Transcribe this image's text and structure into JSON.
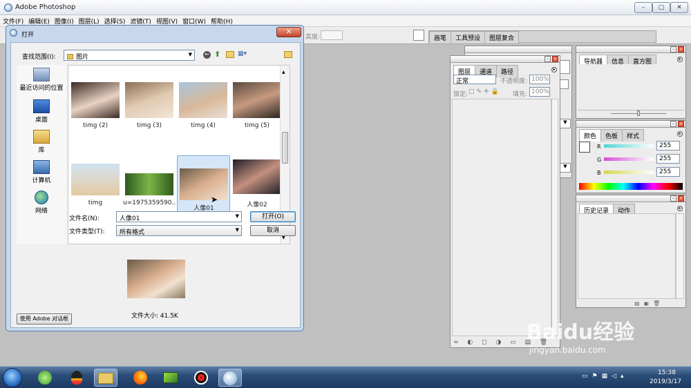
{
  "app": {
    "title": "Adobe Photoshop",
    "window_buttons": [
      "–",
      "▢",
      "✕"
    ]
  },
  "menu": [
    "文件(F)",
    "编辑(E)",
    "图像(I)",
    "图层(L)",
    "选择(S)",
    "滤镜(T)",
    "视图(V)",
    "窗口(W)",
    "帮助(H)"
  ],
  "options_bar": {
    "height_label": "高度:",
    "tabs": [
      "画笔",
      "工具预设",
      "图层复合"
    ]
  },
  "layers_panel": {
    "tabs": [
      "图层",
      "通道",
      "路径"
    ],
    "blend_mode": "正常",
    "opacity_label": "不透明度:",
    "opacity_value": "100%",
    "lock_label": "锁定:",
    "fill_label": "填充:",
    "fill_value": "100%"
  },
  "navigator_panel": {
    "tabs": [
      "导航器",
      "信息",
      "直方图"
    ]
  },
  "color_panel": {
    "tabs": [
      "颜色",
      "色板",
      "样式"
    ],
    "channels": [
      {
        "label": "R",
        "value": "255",
        "color": "#4fd5d5"
      },
      {
        "label": "G",
        "value": "255",
        "color": "#d64fd6"
      },
      {
        "label": "B",
        "value": "255",
        "color": "#d6d64f"
      }
    ]
  },
  "history_panel": {
    "tabs": [
      "历史记录",
      "动作"
    ]
  },
  "open_dialog": {
    "title": "打开",
    "close_label": "✕",
    "look_in_label": "查找范围(I):",
    "look_in_value": "图片",
    "places": [
      {
        "label": "最近访问的位置",
        "icon": "recent-places-icon"
      },
      {
        "label": "桌面",
        "icon": "desktop-icon"
      },
      {
        "label": "库",
        "icon": "libraries-icon"
      },
      {
        "label": "计算机",
        "icon": "computer-icon"
      },
      {
        "label": "网络",
        "icon": "network-icon"
      }
    ],
    "files": [
      {
        "name": "timg (2)",
        "colors": [
          "#e9d2c3",
          "#3a2a22"
        ]
      },
      {
        "name": "timg (3)",
        "colors": [
          "#e0c9b0",
          "#8b6e55"
        ]
      },
      {
        "name": "timg (4)",
        "colors": [
          "#a9c4dc",
          "#d8b89a"
        ]
      },
      {
        "name": "timg (5)",
        "colors": [
          "#5b4a40",
          "#c79a80"
        ]
      },
      {
        "name": "timg",
        "colors": [
          "#cfe2f0",
          "#e3c9a0"
        ]
      },
      {
        "name": "u=1975359590...",
        "colors": [
          "#2f5a1e",
          "#7cb548"
        ]
      },
      {
        "name": "人像01",
        "colors": [
          "#d9b08f",
          "#6b5a48"
        ]
      },
      {
        "name": "人像02",
        "colors": [
          "#1e1e28",
          "#c4907e"
        ]
      }
    ],
    "filename_label": "文件名(N):",
    "filename_value": "人像01",
    "filetype_label": "文件类型(T):",
    "filetype_value": "所有格式",
    "open_button": "打开(O)",
    "cancel_button": "取消",
    "file_size": "文件大小: 41.5K",
    "use_adobe_button": "使用 Adobe 对话框"
  },
  "taskbar": {
    "time": "15:38",
    "date": "2019/3/17"
  },
  "watermark": {
    "brand": "Baidu经验",
    "url": "jingyan.baidu.com"
  }
}
